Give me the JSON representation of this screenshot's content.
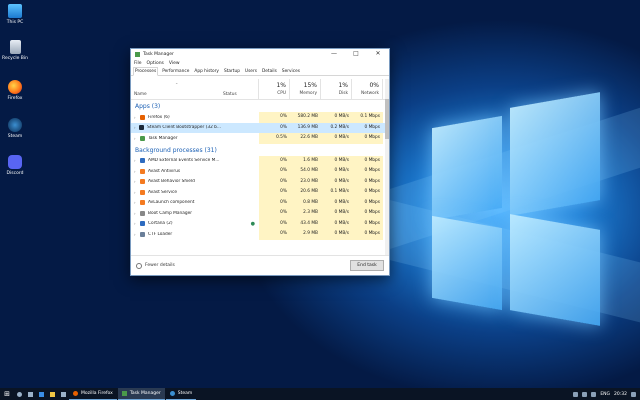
{
  "desktop_icons": [
    {
      "label": "This PC",
      "icon": "this-pc-icon"
    },
    {
      "label": "Recycle Bin",
      "icon": "recycle-bin-icon"
    },
    {
      "label": "Firefox",
      "icon": "firefox-icon"
    },
    {
      "label": "Steam",
      "icon": "steam-icon"
    },
    {
      "label": "Discord",
      "icon": "discord-icon"
    }
  ],
  "window": {
    "title": "Task Manager",
    "menu": [
      "File",
      "Options",
      "View"
    ],
    "tabs": [
      "Processes",
      "Performance",
      "App history",
      "Startup",
      "Users",
      "Details",
      "Services"
    ],
    "active_tab": "Processes"
  },
  "columns": {
    "name": "Name",
    "status": "Status",
    "cpu": {
      "pct": "1%",
      "label": "CPU"
    },
    "memory": {
      "pct": "15%",
      "label": "Memory"
    },
    "disk": {
      "pct": "1%",
      "label": "Disk"
    },
    "network": {
      "pct": "0%",
      "label": "Network"
    }
  },
  "apps_group": "Apps (3)",
  "apps": [
    {
      "name": "Firefox (6)",
      "cpu": "0%",
      "memory": "580.2 MB",
      "disk": "0 MB/s",
      "network": "0.1 Mbps",
      "color": "#e66000"
    },
    {
      "name": "Steam Client Bootstrapper (32 b...",
      "cpu": "0%",
      "memory": "136.9 MB",
      "disk": "0.2 MB/s",
      "network": "0 Mbps",
      "color": "#1b2838"
    },
    {
      "name": "Task Manager",
      "cpu": "0.5%",
      "memory": "22.6 MB",
      "disk": "0 MB/s",
      "network": "0 Mbps",
      "color": "#4a9a4a"
    }
  ],
  "bg_group": "Background processes (31)",
  "background": [
    {
      "name": "AMD External Events Service M...",
      "cpu": "0%",
      "memory": "1.6 MB",
      "disk": "0 MB/s",
      "network": "0 Mbps",
      "color": "#2d6bbf"
    },
    {
      "name": "Avast Antivirus",
      "cpu": "0%",
      "memory": "54.0 MB",
      "disk": "0 MB/s",
      "network": "0 Mbps",
      "color": "#f47a20"
    },
    {
      "name": "Avast Behavior Shield",
      "cpu": "0%",
      "memory": "23.0 MB",
      "disk": "0 MB/s",
      "network": "0 Mbps",
      "color": "#f47a20"
    },
    {
      "name": "Avast Service",
      "cpu": "0%",
      "memory": "20.6 MB",
      "disk": "0.1 MB/s",
      "network": "0 Mbps",
      "color": "#f47a20"
    },
    {
      "name": "AvLaunch component",
      "cpu": "0%",
      "memory": "0.8 MB",
      "disk": "0 MB/s",
      "network": "0 Mbps",
      "color": "#f47a20"
    },
    {
      "name": "Boot Camp Manager",
      "cpu": "0%",
      "memory": "2.3 MB",
      "disk": "0 MB/s",
      "network": "0 Mbps",
      "color": "#888888"
    },
    {
      "name": "Cortana (2)",
      "cpu": "0%",
      "memory": "43.4 MB",
      "disk": "0 MB/s",
      "network": "0 Mbps",
      "color": "#2d6bbf"
    },
    {
      "name": "CTF Loader",
      "cpu": "0%",
      "memory": "2.9 MB",
      "disk": "0 MB/s",
      "network": "0 Mbps",
      "color": "#6a7f99"
    }
  ],
  "footer": {
    "fewer_details": "Fewer details",
    "end_task": "End task"
  },
  "taskbar": {
    "apps": [
      "Mozilla Firefox",
      "Task Manager",
      "Steam"
    ],
    "active_app": "Task Manager",
    "lang": "ENG",
    "time": "20:32"
  }
}
